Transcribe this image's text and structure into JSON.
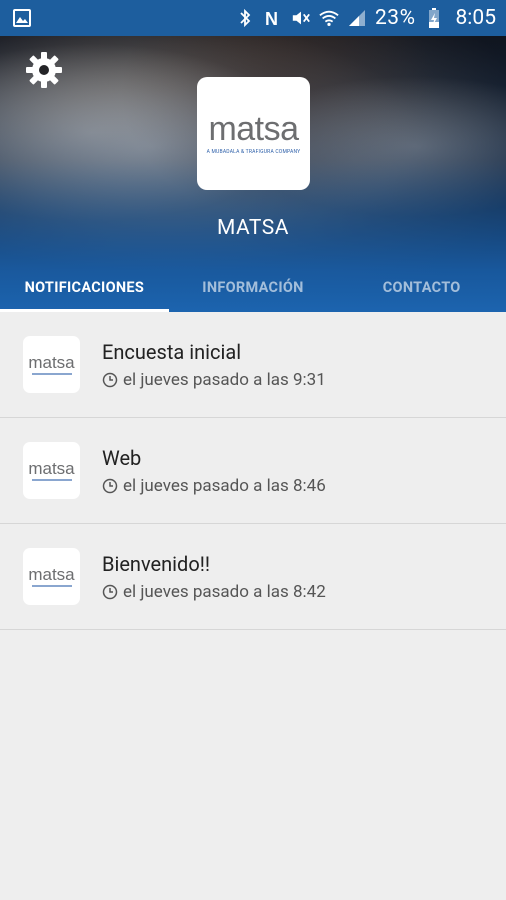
{
  "statusbar": {
    "battery_pct": "23%",
    "time": "8:05",
    "icons": [
      "gallery-icon",
      "bluetooth-icon",
      "nfc-icon",
      "mute-icon",
      "wifi-icon",
      "signal-icon",
      "battery-icon"
    ]
  },
  "header": {
    "logo_text": "matsa",
    "logo_tagline": "A MUBADALA & TRAFIGURA COMPANY",
    "company_name": "MATSA"
  },
  "tabs": [
    {
      "label": "NOTIFICACIONES",
      "active": true
    },
    {
      "label": "INFORMACIÓN",
      "active": false
    },
    {
      "label": "CONTACTO",
      "active": false
    }
  ],
  "notifications": [
    {
      "title": "Encuesta inicial",
      "time": "el jueves pasado a las 9:31",
      "icon_text": "matsa"
    },
    {
      "title": "Web",
      "time": "el jueves pasado a las 8:46",
      "icon_text": "matsa"
    },
    {
      "title": "Bienvenido!!",
      "time": "el jueves pasado a las 8:42",
      "icon_text": "matsa"
    }
  ],
  "colors": {
    "statusbar": "#1d5e9e",
    "accent": "#1c64af",
    "background": "#eeeeee"
  }
}
